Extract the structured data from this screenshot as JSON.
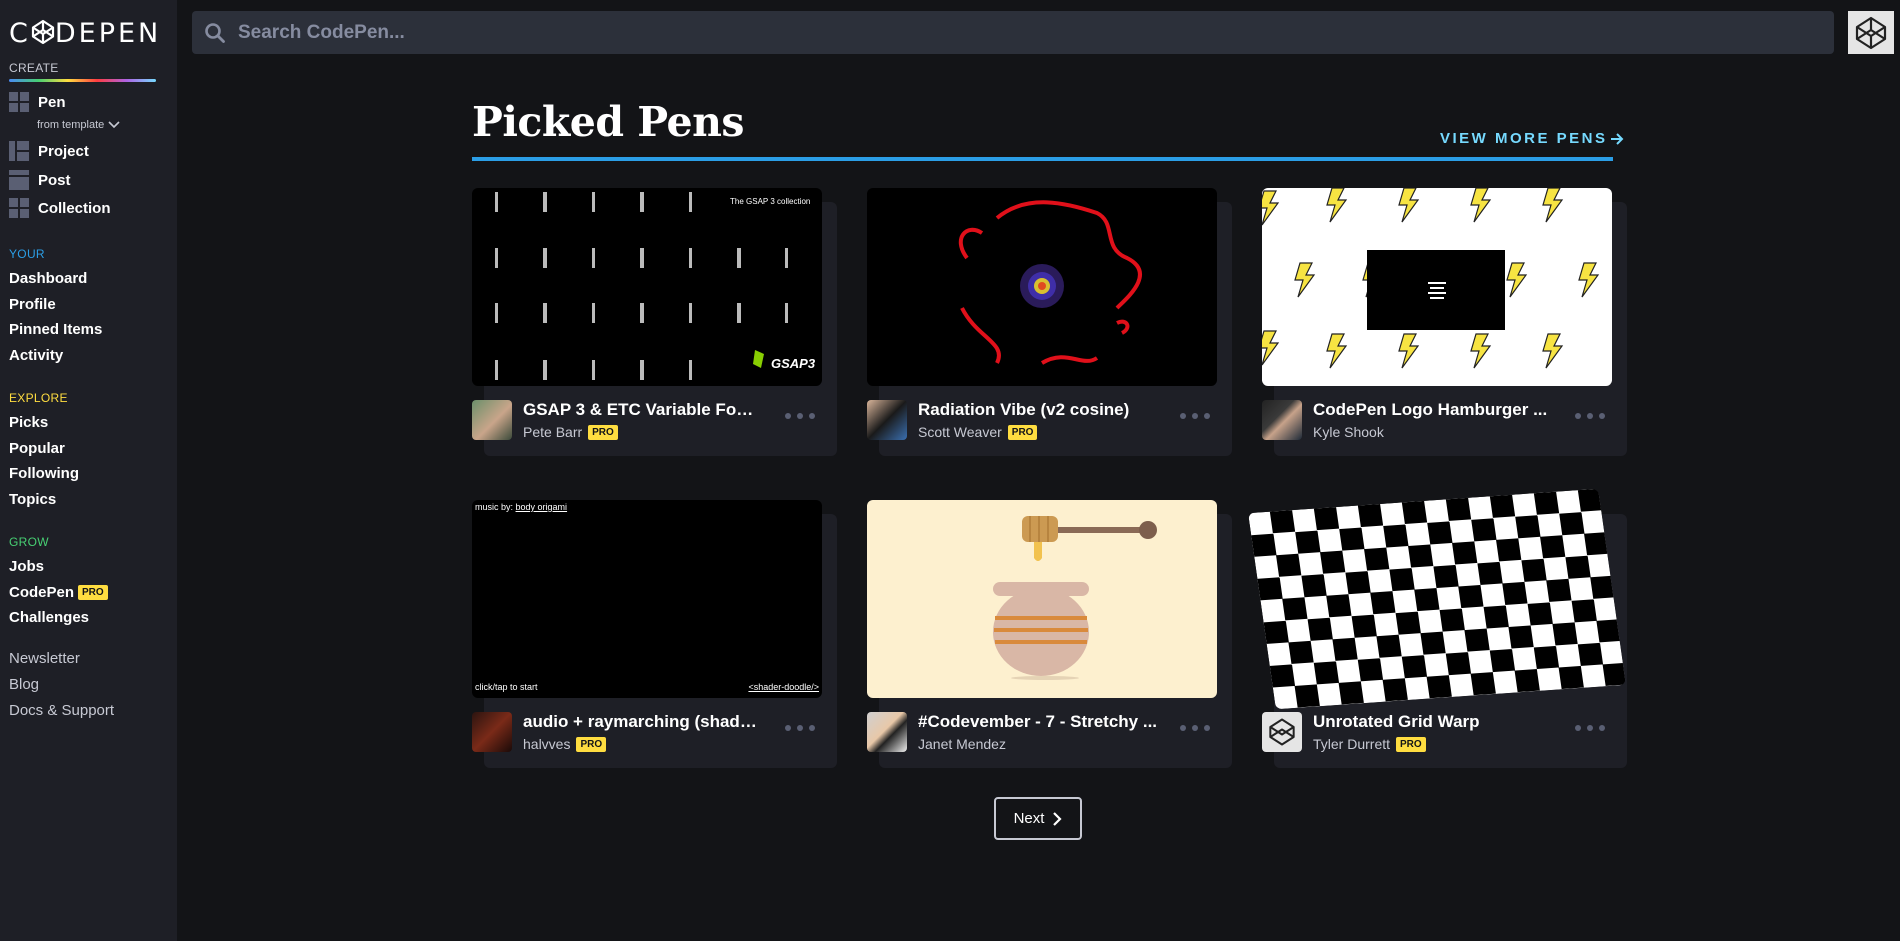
{
  "brand": {
    "logo_text": "CODEPEN"
  },
  "sidebar": {
    "create_label": "CREATE",
    "create_items": [
      {
        "label": "Pen",
        "icon": "pen-grid-icon"
      },
      {
        "label": "Project",
        "icon": "project-grid-icon"
      },
      {
        "label": "Post",
        "icon": "post-grid-icon"
      },
      {
        "label": "Collection",
        "icon": "collection-grid-icon"
      }
    ],
    "from_template": "from template",
    "your_label": "YOUR",
    "your_items": [
      "Dashboard",
      "Profile",
      "Pinned Items",
      "Activity"
    ],
    "explore_label": "EXPLORE",
    "explore_items": [
      "Picks",
      "Popular",
      "Following",
      "Topics"
    ],
    "grow_label": "GROW",
    "grow_items": [
      "Jobs",
      "CodePen",
      "Challenges"
    ],
    "grow_pro_badge": "PRO",
    "footer_links": [
      "Newsletter",
      "Blog",
      "Docs & Support"
    ],
    "colors": {
      "your": "#2b9ee6",
      "explore": "#ffdd40",
      "grow": "#47cf73"
    }
  },
  "search": {
    "placeholder": "Search CodePen..."
  },
  "main": {
    "title": "Picked Pens",
    "view_more": "VIEW MORE PENS",
    "next": "Next"
  },
  "pens": [
    {
      "title": "GSAP 3 & ETC Variable Font ...",
      "author": "Pete Barr",
      "pro": "PRO",
      "thumb_caption": "The GSAP 3 collection",
      "thumb_logo": "GSAP3"
    },
    {
      "title": "Radiation Vibe (v2 cosine)",
      "author": "Scott Weaver",
      "pro": "PRO"
    },
    {
      "title": "CodePen Logo Hamburger ...",
      "author": "Kyle Shook",
      "pro": ""
    },
    {
      "title": "audio + raymarching (shade...",
      "author": "halvves",
      "pro": "PRO",
      "thumb_top": "music by:",
      "thumb_top_link": "body origami",
      "thumb_bottom_left": "click/tap to start",
      "thumb_bottom_right": "<shader-doodle/>"
    },
    {
      "title": "#Codevember - 7 - Stretchy ...",
      "author": "Janet Mendez",
      "pro": ""
    },
    {
      "title": "Unrotated Grid Warp",
      "author": "Tyler Durrett",
      "pro": "PRO"
    }
  ]
}
